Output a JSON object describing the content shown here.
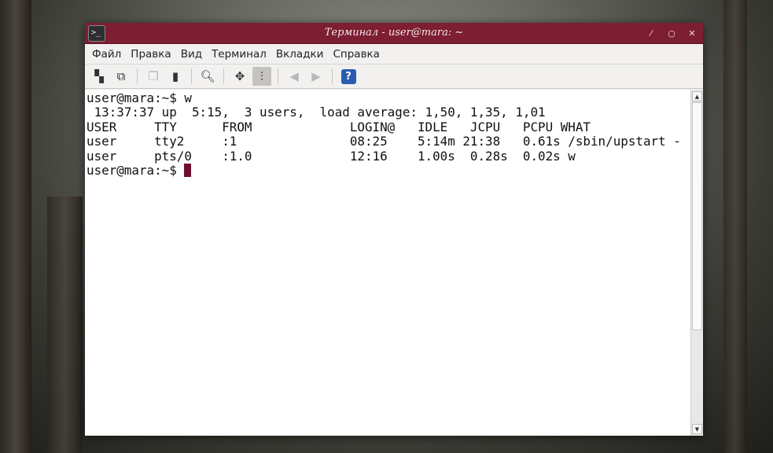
{
  "window": {
    "title": "Терминал - user@mara: ~",
    "icon": "terminal-icon",
    "controls": [
      "minimize",
      "maximize",
      "close"
    ]
  },
  "menu": [
    {
      "label": "Файл"
    },
    {
      "label": "Правка"
    },
    {
      "label": "Вид"
    },
    {
      "label": "Терминал"
    },
    {
      "label": "Вкладки"
    },
    {
      "label": "Справка"
    }
  ],
  "toolbar": {
    "help_label": "?"
  },
  "terminal": {
    "lines": [
      "user@mara:~$ w",
      " 13:37:37 up  5:15,  3 users,  load average: 1,50, 1,35, 1,01",
      "USER     TTY      FROM             LOGIN@   IDLE   JCPU   PCPU WHAT",
      "user     tty2     :1               08:25    5:14m 21:38   0.61s /sbin/upstart -",
      "user     pts/0    :1.0             12:16    1.00s  0.28s  0.02s w"
    ],
    "prompt": "user@mara:~$ "
  },
  "colors": {
    "titlebar": "#7d1e33",
    "cursor": "#6e0f2e"
  }
}
